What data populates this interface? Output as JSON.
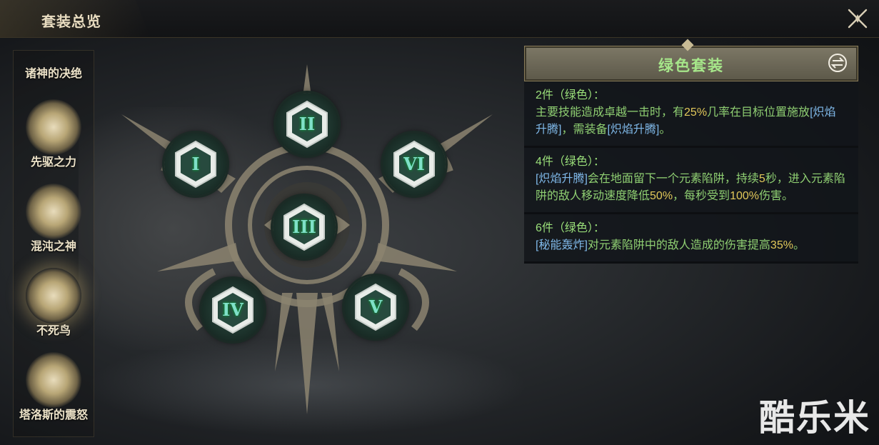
{
  "window": {
    "title": "套装总览",
    "close_icon": "close-x-icon"
  },
  "sets": [
    {
      "label": "诸神的决绝",
      "icon": "god-emblem-icon",
      "selected": false
    },
    {
      "label": "先驱之力",
      "icon": "pioneer-emblem-icon",
      "selected": false
    },
    {
      "label": "混沌之神",
      "icon": "chaos-eye-emblem-icon",
      "selected": false
    },
    {
      "label": "不死鸟",
      "icon": "phoenix-emblem-icon",
      "selected": true
    },
    {
      "label": "塔洛斯的震怒",
      "icon": "talos-emblem-icon",
      "selected": false
    }
  ],
  "slots": [
    {
      "numeral": "I"
    },
    {
      "numeral": "II"
    },
    {
      "numeral": "III"
    },
    {
      "numeral": "IV"
    },
    {
      "numeral": "V"
    },
    {
      "numeral": "VI"
    }
  ],
  "detail": {
    "title": "绿色套装",
    "swap_icon": "swap-icon",
    "tiers": [
      {
        "head": "2件（绿色）：",
        "segments": [
          {
            "t": "主要技能造成卓越一击时，有",
            "c": "tier-body"
          },
          {
            "t": "25%",
            "c": "hl"
          },
          {
            "t": "几率在目标位置施放",
            "c": "tier-body"
          },
          {
            "t": "[炽焰升腾]",
            "c": "skill"
          },
          {
            "t": "，需装备",
            "c": "tier-body"
          },
          {
            "t": "[炽焰升腾]",
            "c": "skill"
          },
          {
            "t": "。",
            "c": "tier-body"
          }
        ]
      },
      {
        "head": "4件（绿色）：",
        "segments": [
          {
            "t": "[炽焰升腾]",
            "c": "skill"
          },
          {
            "t": "会在地面留下一个元素陷阱，持续",
            "c": "tier-body"
          },
          {
            "t": "5",
            "c": "hl"
          },
          {
            "t": "秒，进入元素陷阱的敌人移动速度降低",
            "c": "tier-body"
          },
          {
            "t": "50%",
            "c": "hl"
          },
          {
            "t": "，每秒受到",
            "c": "tier-body"
          },
          {
            "t": "100%",
            "c": "hl"
          },
          {
            "t": "伤害。",
            "c": "tier-body"
          }
        ]
      },
      {
        "head": "6件（绿色）：",
        "segments": [
          {
            "t": "[秘能轰炸]",
            "c": "skill"
          },
          {
            "t": "对元素陷阱中的敌人造成的伤害提高",
            "c": "tier-body"
          },
          {
            "t": "35%",
            "c": "hl"
          },
          {
            "t": "。",
            "c": "tier-body"
          }
        ]
      }
    ]
  },
  "watermark": "酷乐米"
}
